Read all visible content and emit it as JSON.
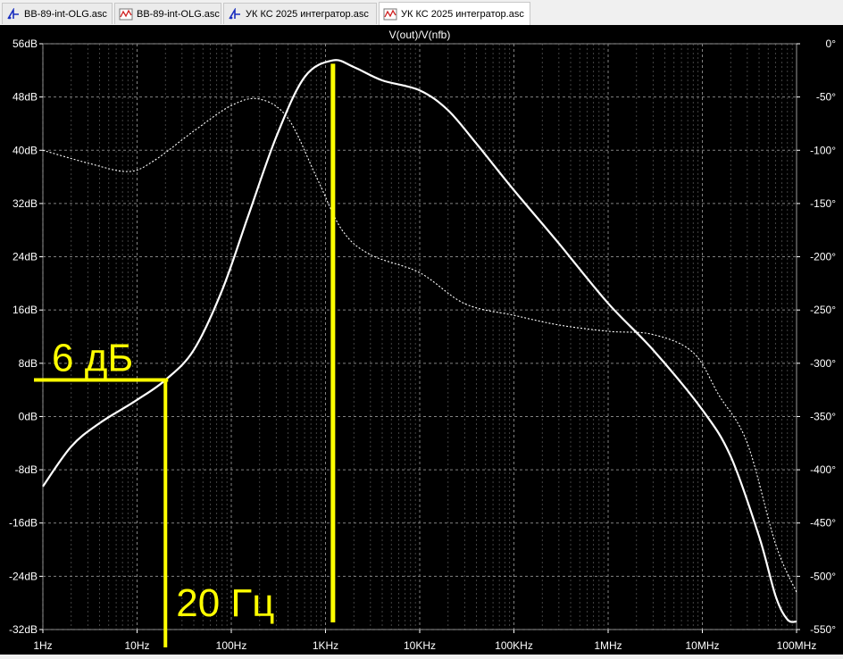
{
  "tabs": [
    {
      "label": "BB-89-int-OLG.asc",
      "icon": "schematic-icon",
      "active": false
    },
    {
      "label": "BB-89-int-OLG.asc",
      "icon": "waveform-icon",
      "active": false
    },
    {
      "label": "УК КС 2025 интегратор.asc",
      "icon": "schematic-icon",
      "active": false
    },
    {
      "label": "УК КС 2025 интегратор.asc",
      "icon": "waveform-icon",
      "active": true
    }
  ],
  "colors": {
    "background": "#000000",
    "trace": "#ffffff",
    "annotation": "#ffff00",
    "grid": "#8a8a8a"
  },
  "chart_data": {
    "type": "line",
    "title": "V(out)/V(nfb)",
    "x_scale": "log",
    "xlim": [
      1,
      100000000
    ],
    "x_ticks": [
      {
        "value": 1,
        "label": "1Hz"
      },
      {
        "value": 10,
        "label": "10Hz"
      },
      {
        "value": 100,
        "label": "100Hz"
      },
      {
        "value": 1000,
        "label": "1KHz"
      },
      {
        "value": 10000,
        "label": "10KHz"
      },
      {
        "value": 100000,
        "label": "100KHz"
      },
      {
        "value": 1000000,
        "label": "1MHz"
      },
      {
        "value": 10000000,
        "label": "10MHz"
      },
      {
        "value": 100000000,
        "label": "100MHz"
      }
    ],
    "ylim_left": [
      -32,
      56
    ],
    "y_ticks_left": [
      {
        "value": 56,
        "label": "56dB"
      },
      {
        "value": 48,
        "label": "48dB"
      },
      {
        "value": 40,
        "label": "40dB"
      },
      {
        "value": 32,
        "label": "32dB"
      },
      {
        "value": 24,
        "label": "24dB"
      },
      {
        "value": 16,
        "label": "16dB"
      },
      {
        "value": 8,
        "label": "8dB"
      },
      {
        "value": 0,
        "label": "0dB"
      },
      {
        "value": -8,
        "label": "-8dB"
      },
      {
        "value": -16,
        "label": "-16dB"
      },
      {
        "value": -24,
        "label": "-24dB"
      },
      {
        "value": -32,
        "label": "-32dB"
      }
    ],
    "ylim_right": [
      -550,
      0
    ],
    "y_ticks_right": [
      {
        "value": 0,
        "label": "0°"
      },
      {
        "value": -50,
        "label": "-50°"
      },
      {
        "value": -100,
        "label": "-100°"
      },
      {
        "value": -150,
        "label": "-150°"
      },
      {
        "value": -200,
        "label": "-200°"
      },
      {
        "value": -250,
        "label": "-250°"
      },
      {
        "value": -300,
        "label": "-300°"
      },
      {
        "value": -350,
        "label": "-350°"
      },
      {
        "value": -400,
        "label": "-400°"
      },
      {
        "value": -450,
        "label": "-450°"
      },
      {
        "value": -500,
        "label": "-500°"
      },
      {
        "value": -550,
        "label": "-550°"
      }
    ],
    "grid": true,
    "series": [
      {
        "kind": "magnitude",
        "axis": "left",
        "style": "solid",
        "color": "#ffffff",
        "points": [
          [
            1,
            -10.5
          ],
          [
            2,
            -4.5
          ],
          [
            4,
            -1
          ],
          [
            10,
            2.5
          ],
          [
            20,
            5.5
          ],
          [
            40,
            10
          ],
          [
            80,
            19
          ],
          [
            150,
            30
          ],
          [
            300,
            42
          ],
          [
            600,
            51
          ],
          [
            1200,
            53.5
          ],
          [
            2000,
            52.5
          ],
          [
            4000,
            50.5
          ],
          [
            10000,
            49
          ],
          [
            20000,
            46
          ],
          [
            40000,
            41
          ],
          [
            100000,
            34
          ],
          [
            300000,
            26
          ],
          [
            1000000,
            17
          ],
          [
            3000000,
            10
          ],
          [
            10000000,
            1
          ],
          [
            20000000,
            -6
          ],
          [
            40000000,
            -18
          ],
          [
            60000000,
            -27
          ],
          [
            80000000,
            -30.5
          ],
          [
            100000000,
            -30.8
          ]
        ]
      },
      {
        "kind": "phase",
        "axis": "right",
        "style": "dotted",
        "color": "#ffffff",
        "points": [
          [
            1,
            -100
          ],
          [
            3,
            -112
          ],
          [
            8,
            -120
          ],
          [
            15,
            -110
          ],
          [
            40,
            -82
          ],
          [
            100,
            -58
          ],
          [
            200,
            -52
          ],
          [
            400,
            -70
          ],
          [
            800,
            -125
          ],
          [
            1500,
            -175
          ],
          [
            3000,
            -198
          ],
          [
            10000,
            -215
          ],
          [
            30000,
            -244
          ],
          [
            100000,
            -255
          ],
          [
            300000,
            -264
          ],
          [
            1000000,
            -270
          ],
          [
            3000000,
            -273
          ],
          [
            8000000,
            -290
          ],
          [
            15000000,
            -330
          ],
          [
            30000000,
            -375
          ],
          [
            60000000,
            -470
          ],
          [
            100000000,
            -515
          ]
        ]
      }
    ],
    "annotations": [
      {
        "text": "6 дБ",
        "y_db": 5.5,
        "color": "#ffff00"
      },
      {
        "text": "20 Гц",
        "x_hz": 20,
        "color": "#ffff00"
      },
      {
        "text": "",
        "x_hz": 1200,
        "color": "#ffff00"
      }
    ]
  }
}
